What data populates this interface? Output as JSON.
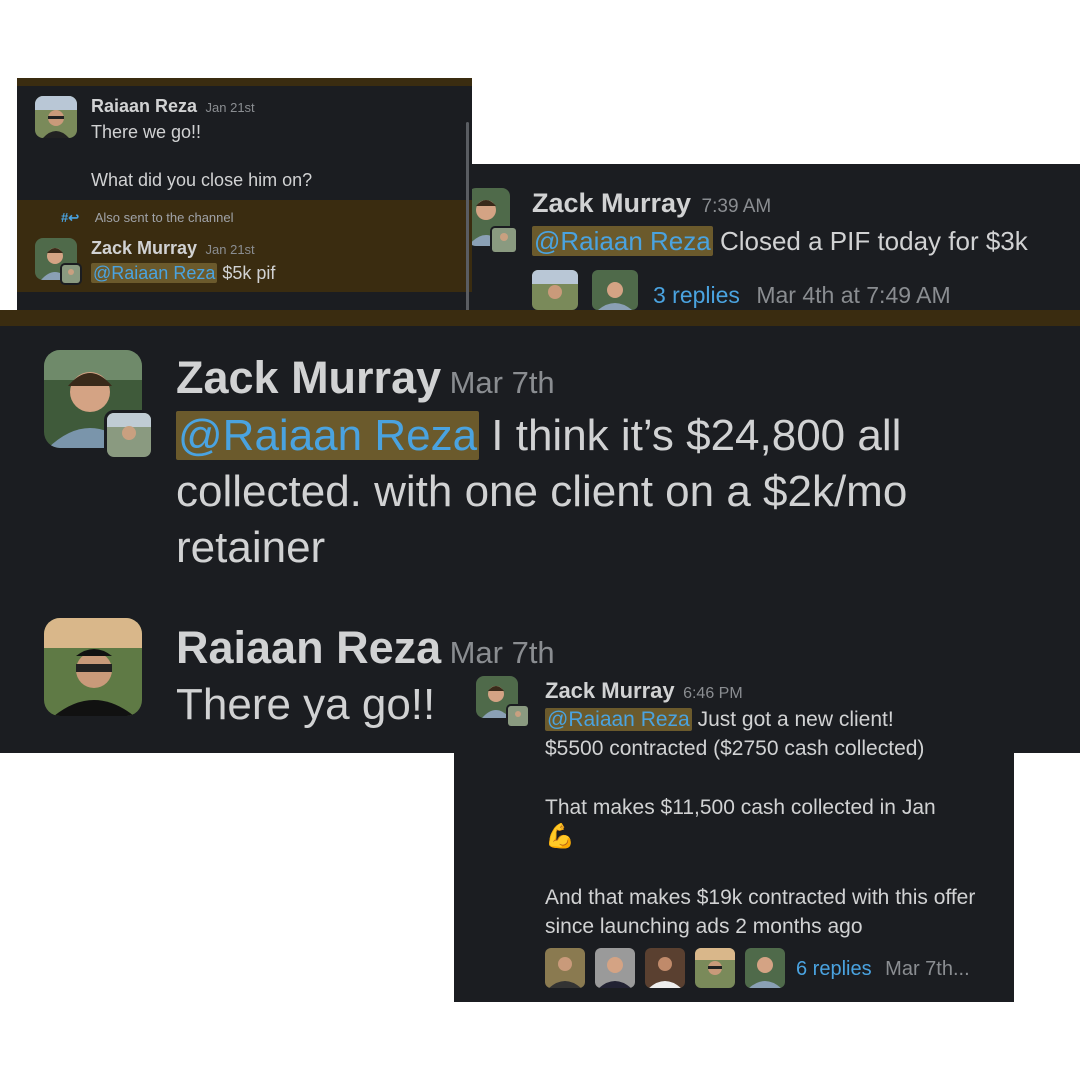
{
  "panel1": {
    "m1": {
      "author": "Raiaan Reza",
      "time": "Jan 21st",
      "line1": "There we go!!",
      "line2": "What did you close him on?"
    },
    "also_sent": "Also sent to the channel",
    "m2": {
      "author": "Zack Murray",
      "time": "Jan 21st",
      "mention": "@Raiaan Reza",
      "text": " $5k pif"
    }
  },
  "panel2": {
    "author": "Zack Murray",
    "time": "7:39 AM",
    "mention": "@Raiaan Reza",
    "text": " Closed a PIF today for $3k",
    "replies": "3 replies",
    "last_reply": "Mar 4th at 7:49 AM"
  },
  "panel3": {
    "m1": {
      "author": "Zack Murray",
      "time": "Mar 7th",
      "mention": "@Raiaan Reza",
      "text": " I think it’s $24,800 all collected. with one client on a $2k/mo retainer"
    },
    "m2": {
      "author": "Raiaan Reza",
      "time": "Mar 7th",
      "text": "There ya go!!"
    }
  },
  "panel4": {
    "author": "Zack Murray",
    "time": "6:46 PM",
    "mention": "@Raiaan Reza",
    "line1": " Just got a new client!",
    "line2": "$5500 contracted ($2750 cash collected)",
    "line3": "That makes $11,500 cash collected in Jan",
    "emoji": "💪",
    "line4": "And that makes $19k contracted with this offer since launching ads 2 months ago",
    "replies": "6 replies",
    "last_reply": "Mar 7th..."
  },
  "colors": {
    "bg": "#1b1d21",
    "mention_bg": "#6b5a2c",
    "link": "#4aa3e0",
    "highlight": "#3a2c10"
  }
}
